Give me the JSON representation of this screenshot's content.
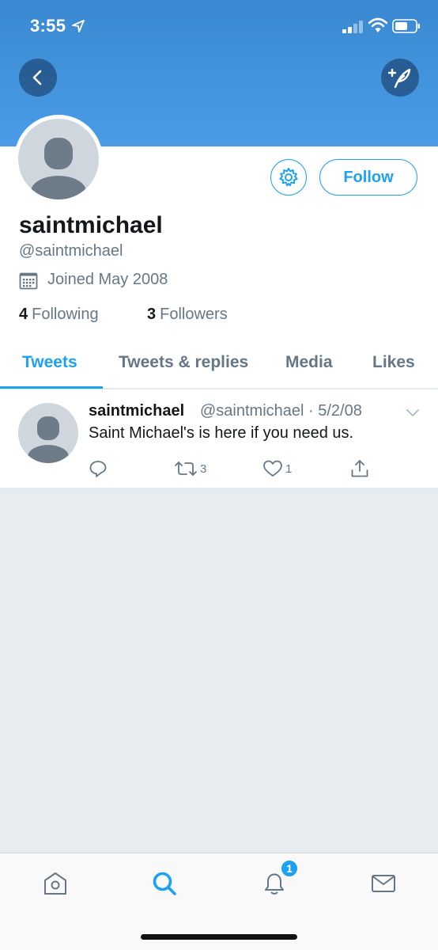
{
  "status_bar": {
    "time": "3:55",
    "icons": [
      "location-arrow-icon",
      "signal-icon",
      "wifi-icon",
      "battery-icon"
    ]
  },
  "header": {
    "back_icon": "chevron-left-icon",
    "compose_icon": "compose-tweet-icon"
  },
  "profile": {
    "display_name": "saintmichael",
    "handle": "@saintmichael",
    "joined": "Joined May 2008",
    "following_count": "4",
    "following_label": "Following",
    "followers_count": "3",
    "followers_label": "Followers",
    "follow_label": "Follow",
    "settings_icon": "gear-icon"
  },
  "tabs": [
    {
      "label": "Tweets",
      "active": true
    },
    {
      "label": "Tweets & replies",
      "active": false
    },
    {
      "label": "Media",
      "active": false
    },
    {
      "label": "Likes",
      "active": false
    }
  ],
  "tweets": [
    {
      "name": "saintmichael",
      "meta": "@saintmichael · 5/2/08",
      "text": "Saint Michael's is here if you need us.",
      "replies": "",
      "retweets": "3",
      "likes": "1"
    }
  ],
  "tabbar": {
    "items": [
      "home-icon",
      "search-icon",
      "notifications-icon",
      "messages-icon"
    ],
    "active": "search-icon",
    "notification_badge": "1"
  },
  "colors": {
    "accent": "#1da1f2",
    "header": "#4a9ce6",
    "muted": "#657786",
    "background": "#e6ecf0"
  }
}
